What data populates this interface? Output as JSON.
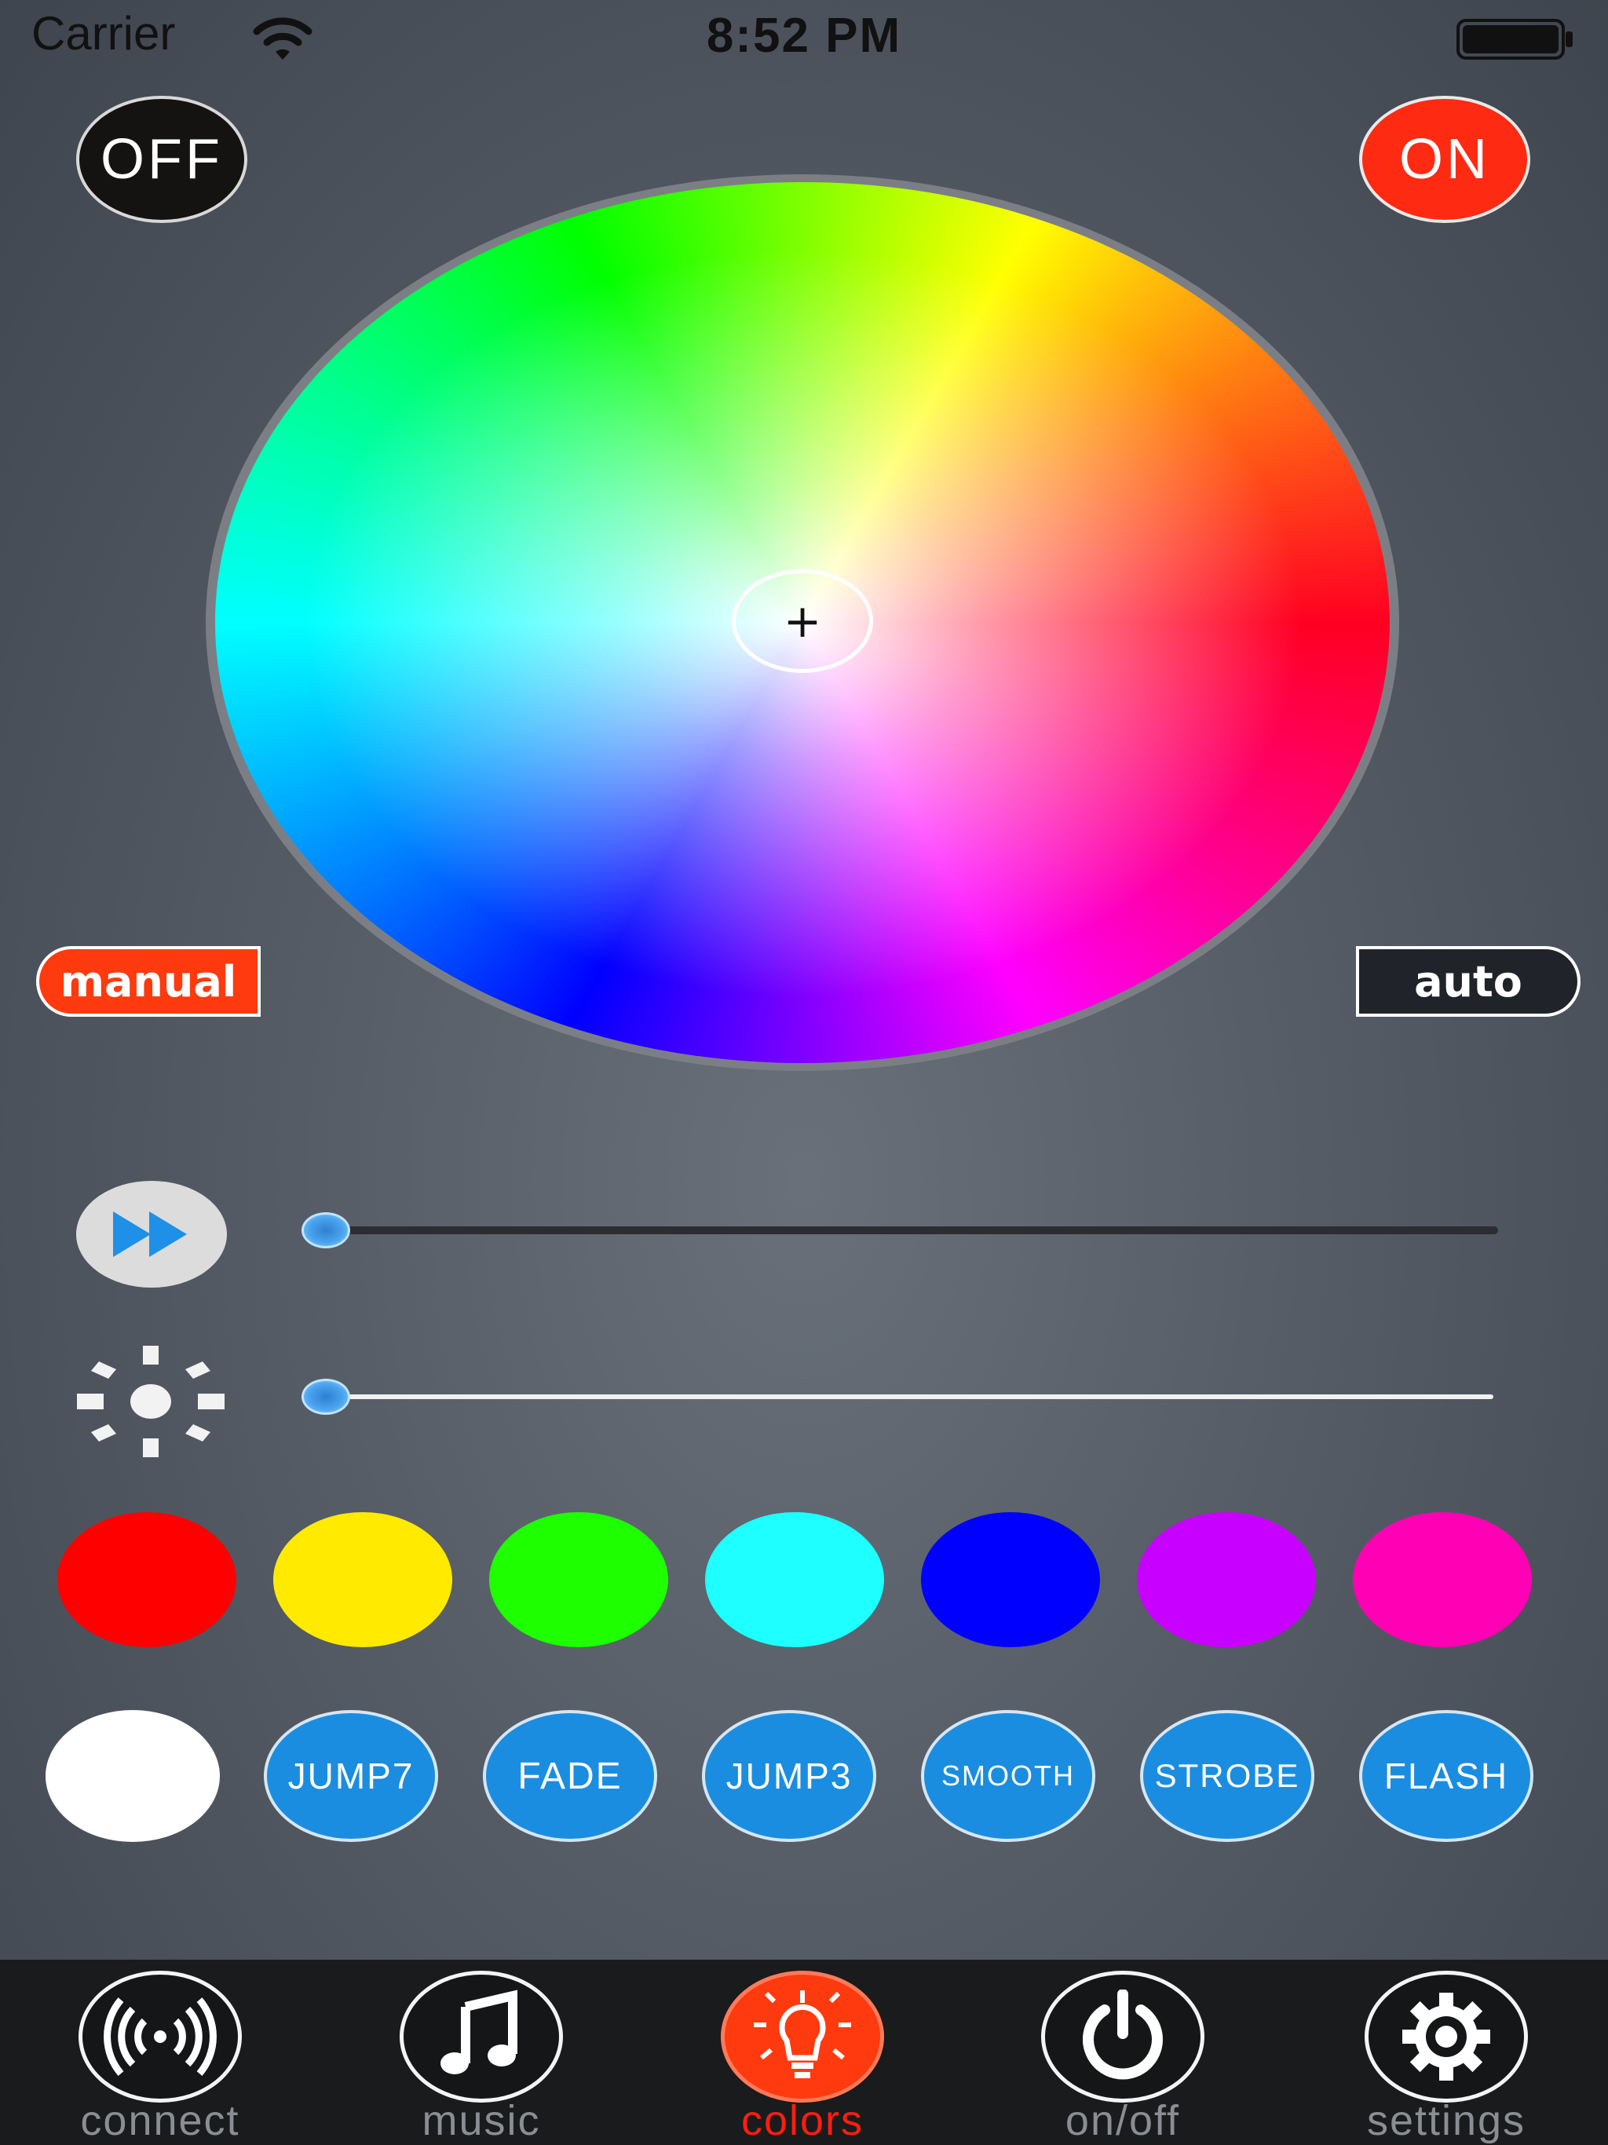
{
  "status_bar": {
    "carrier": "Carrier",
    "time": "8:52 PM",
    "wifi_icon": "wifi-icon",
    "battery_icon": "battery-icon"
  },
  "power": {
    "off_label": "OFF",
    "on_label": "ON",
    "off_color": "#151212",
    "on_color": "#ff2a12"
  },
  "color_wheel": {
    "picker_symbol": "+"
  },
  "modes": {
    "manual_label": "manual",
    "auto_label": "auto",
    "selected": "manual"
  },
  "sliders": {
    "speed": {
      "icon": "fast-forward-icon",
      "value": 0.0
    },
    "brightness": {
      "icon": "brightness-icon",
      "value": 0.0
    }
  },
  "swatches": [
    "#ff0000",
    "#ffea00",
    "#1eff00",
    "#1effff",
    "#0000ff",
    "#c800ff",
    "#ff00b4"
  ],
  "white_swatch": "#ffffff",
  "effects": [
    {
      "label": "JUMP7",
      "size": 46
    },
    {
      "label": "FADE",
      "size": 48
    },
    {
      "label": "JUMP3",
      "size": 46
    },
    {
      "label": "SMOOTH",
      "size": 36
    },
    {
      "label": "STROBE",
      "size": 42
    },
    {
      "label": "FLASH",
      "size": 46
    }
  ],
  "tabs": [
    {
      "label": "connect",
      "icon": "broadcast-icon",
      "active": false
    },
    {
      "label": "music",
      "icon": "music-note-icon",
      "active": false
    },
    {
      "label": "colors",
      "icon": "light-bulb-icon",
      "active": true
    },
    {
      "label": "on/off",
      "icon": "power-icon",
      "active": false
    },
    {
      "label": "settings",
      "icon": "gear-icon",
      "active": false
    }
  ]
}
